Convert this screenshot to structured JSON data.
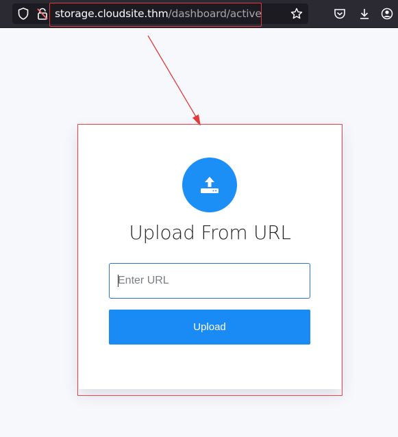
{
  "browser": {
    "url_host": "storage.cloudsite.thm",
    "url_path": "/dashboard/active",
    "icons": [
      "shield-icon",
      "lock-insecure-icon",
      "bookmark-star-icon",
      "pocket-icon",
      "download-icon",
      "account-icon"
    ]
  },
  "main": {
    "title": "Upload From URL",
    "url_input": {
      "placeholder": "Enter URL",
      "value": ""
    },
    "upload_label": "Upload",
    "upload_icon": "upload-icon"
  },
  "annotations": {
    "color": "#e33b3b"
  },
  "colors": {
    "accent": "#1b8ff5",
    "background": "#f7f8fc",
    "toolbar": "#2b2a33"
  }
}
